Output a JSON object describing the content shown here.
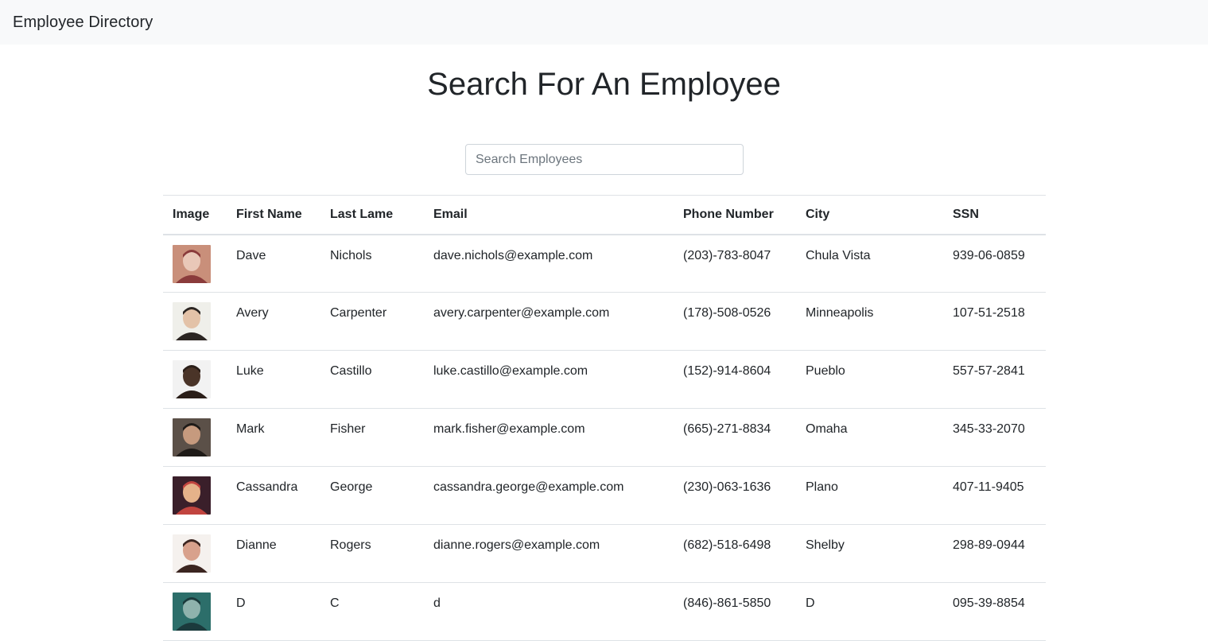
{
  "navbar": {
    "brand": "Employee Directory"
  },
  "page": {
    "title": "Search For An Employee"
  },
  "search": {
    "placeholder": "Search Employees",
    "value": ""
  },
  "table": {
    "headers": {
      "image": "Image",
      "first_name": "First Name",
      "last_name": "Last Lame",
      "email": "Email",
      "phone": "Phone Number",
      "city": "City",
      "ssn": "SSN"
    },
    "rows": [
      {
        "first": "Dave",
        "last": "Nichols",
        "email": "dave.nichols@example.com",
        "phone": "(203)-783-8047",
        "city": "Chula Vista",
        "ssn": "939-06-0859",
        "avatar_colors": [
          "#c98f7a",
          "#8a3b3b",
          "#e9c8b8"
        ]
      },
      {
        "first": "Avery",
        "last": "Carpenter",
        "email": "avery.carpenter@example.com",
        "phone": "(178)-508-0526",
        "city": "Minneapolis",
        "ssn": "107-51-2518",
        "avatar_colors": [
          "#efefea",
          "#2b2522",
          "#e3c2a8"
        ]
      },
      {
        "first": "Luke",
        "last": "Castillo",
        "email": "luke.castillo@example.com",
        "phone": "(152)-914-8604",
        "city": "Pueblo",
        "ssn": "557-57-2841",
        "avatar_colors": [
          "#f2f2f2",
          "#2a1e18",
          "#4a3428"
        ]
      },
      {
        "first": "Mark",
        "last": "Fisher",
        "email": "mark.fisher@example.com",
        "phone": "(665)-271-8834",
        "city": "Omaha",
        "ssn": "345-33-2070",
        "avatar_colors": [
          "#5b5048",
          "#1f1b18",
          "#c69a7e"
        ]
      },
      {
        "first": "Cassandra",
        "last": "George",
        "email": "cassandra.george@example.com",
        "phone": "(230)-063-1636",
        "city": "Plano",
        "ssn": "407-11-9405",
        "avatar_colors": [
          "#3a1f2a",
          "#c1443f",
          "#e5b28a"
        ]
      },
      {
        "first": "Dianne",
        "last": "Rogers",
        "email": "dianne.rogers@example.com",
        "phone": "(682)-518-6498",
        "city": "Shelby",
        "ssn": "298-89-0944",
        "avatar_colors": [
          "#f5f1ee",
          "#3b2520",
          "#d8a18c"
        ]
      },
      {
        "first": "D",
        "last": "C",
        "email": "d",
        "phone": "(846)-861-5850",
        "city": "D",
        "ssn": "095-39-8854",
        "avatar_colors": [
          "#2c6e6a",
          "#1b3a3c",
          "#8fb2ad"
        ]
      }
    ]
  }
}
